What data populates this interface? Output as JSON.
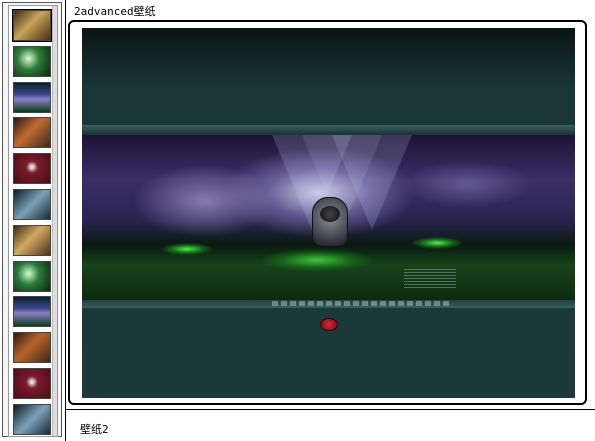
{
  "title": "2advanced壁纸",
  "caption": "壁纸2",
  "thumbnails": [
    {
      "name": "thumb-1",
      "bg": "linear-gradient(135deg,#3b2a14,#c9a25a 45%,#4a3018)"
    },
    {
      "name": "thumb-2",
      "bg": "radial-gradient(circle at 40% 40%,#d8ffd0,#2f7a3a 40%,#0d2210)"
    },
    {
      "name": "thumb-3",
      "bg": "linear-gradient(#0d1f2a,#3a4a8a 40%,#8a80c8 55%,#0d3a1a)"
    },
    {
      "name": "thumb-4",
      "bg": "linear-gradient(135deg,#2a1a10,#c06a30 45%,#3a2a1a)"
    },
    {
      "name": "thumb-5",
      "bg": "radial-gradient(circle at 50% 45%,#e0e0e0 5%,#7a1a2a 25%,#4a0d18)"
    },
    {
      "name": "thumb-6",
      "bg": "linear-gradient(135deg,#0d1a22,#7aa0b8 50%,#1a2a33)"
    },
    {
      "name": "thumb-7",
      "bg": "linear-gradient(135deg,#3b2a14,#d2a862 45%,#4a3018)"
    },
    {
      "name": "thumb-8",
      "bg": "radial-gradient(circle at 40% 40%,#d0ffd0,#2a7a3a 40%,#0d2210)"
    },
    {
      "name": "thumb-9",
      "bg": "linear-gradient(#0d1f2a,#3a4a8a 40%,#8a80c8 55%,#0d3a1a)"
    },
    {
      "name": "thumb-10",
      "bg": "linear-gradient(135deg,#2a1a10,#b8642a 45%,#3a2a1a)"
    },
    {
      "name": "thumb-11",
      "bg": "radial-gradient(circle at 50% 45%,#e0e0e0 5%,#7a1a2a 25%,#4a0d18)"
    },
    {
      "name": "thumb-12",
      "bg": "linear-gradient(135deg,#0d1a22,#7aa0b8 50%,#1a2a33)"
    }
  ]
}
